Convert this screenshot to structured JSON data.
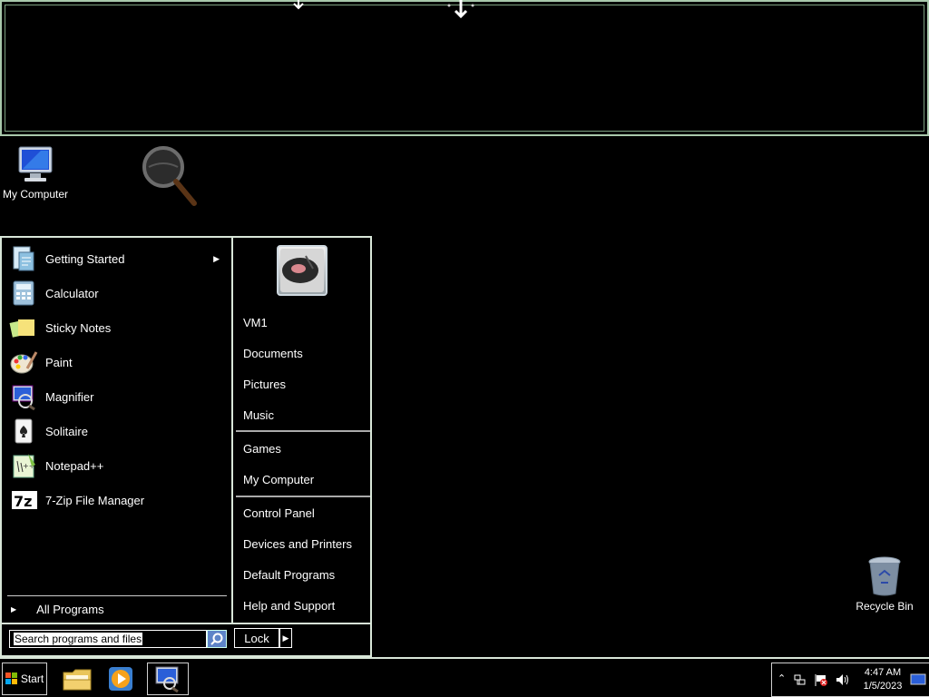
{
  "desktop": {
    "icons": {
      "my_computer": "My Computer",
      "recycle_bin": "Recycle Bin"
    }
  },
  "start_menu": {
    "programs": [
      {
        "label": "Getting Started",
        "icon": "getting-started-icon",
        "has_submenu": true
      },
      {
        "label": "Calculator",
        "icon": "calculator-icon"
      },
      {
        "label": "Sticky Notes",
        "icon": "sticky-notes-icon"
      },
      {
        "label": "Paint",
        "icon": "paint-icon"
      },
      {
        "label": "Magnifier",
        "icon": "magnifier-icon"
      },
      {
        "label": "Solitaire",
        "icon": "solitaire-icon"
      },
      {
        "label": "Notepad++",
        "icon": "notepad-plus-plus-icon"
      },
      {
        "label": "7-Zip File Manager",
        "icon": "seven-zip-icon"
      }
    ],
    "all_programs": "All Programs",
    "search_placeholder": "Search programs and files",
    "right_items": {
      "user": "VM1",
      "documents": "Documents",
      "pictures": "Pictures",
      "music": "Music",
      "games": "Games",
      "my_computer": "My Computer",
      "control_panel": "Control Panel",
      "devices_printers": "Devices and Printers",
      "default_programs": "Default Programs",
      "help_support": "Help and Support"
    },
    "lock_label": "Lock"
  },
  "taskbar": {
    "start_label": "Start",
    "clock_time": "4:47 AM",
    "clock_date": "1/5/2023"
  },
  "colors": {
    "border": "#d8e6d8",
    "magnifier_border": "#a9c9ac",
    "search_button": "#5e84c8"
  }
}
